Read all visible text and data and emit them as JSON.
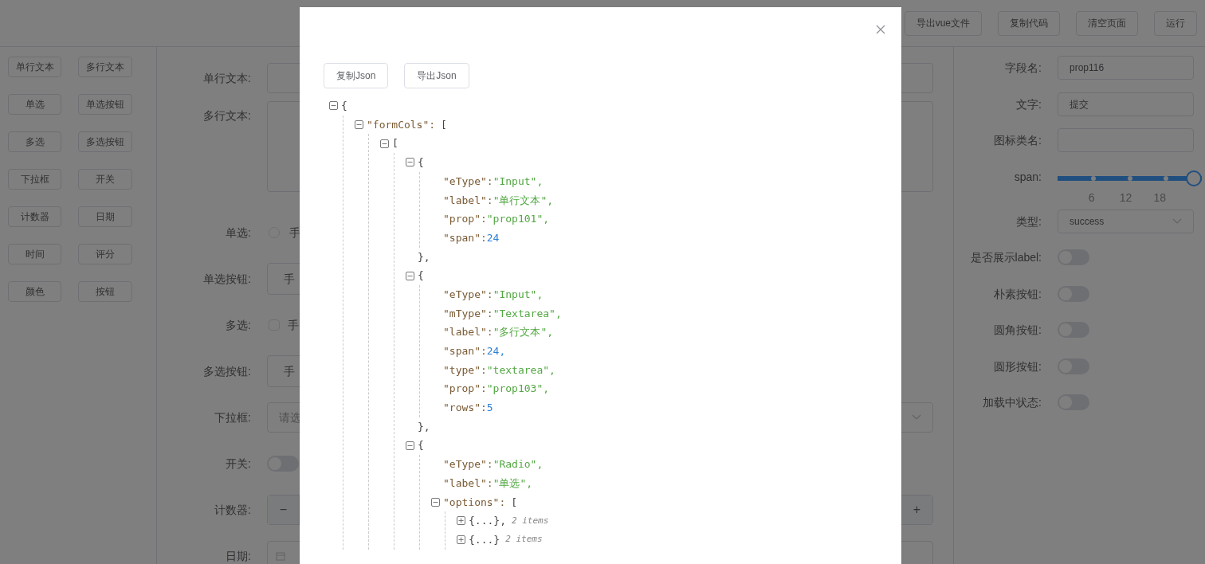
{
  "toolbar": {
    "buttons": [
      "导出vue文件",
      "复制代码",
      "清空页面",
      "运行"
    ]
  },
  "components": [
    "单行文本",
    "多行文本",
    "单选",
    "单选按钮",
    "多选",
    "多选按钮",
    "下拉框",
    "开关",
    "计数器",
    "日期",
    "时间",
    "评分",
    "颜色",
    "按钮"
  ],
  "form": {
    "rows": [
      {
        "kind": "input",
        "label": "单行文本:"
      },
      {
        "kind": "textarea",
        "label": "多行文本:"
      },
      {
        "kind": "radio",
        "label": "单选:",
        "option": "手",
        "checked": false
      },
      {
        "kind": "radio-button",
        "label": "单选按钮:",
        "option": "手"
      },
      {
        "kind": "checkbox",
        "label": "多选:",
        "option": "手",
        "checked": false
      },
      {
        "kind": "checkbox-button",
        "label": "多选按钮:",
        "option": "手"
      },
      {
        "kind": "select",
        "label": "下拉框:",
        "placeholder": "请选"
      },
      {
        "kind": "switch",
        "label": "开关:",
        "on": false
      },
      {
        "kind": "stepper",
        "label": "计数器:",
        "minus": "−",
        "plus": "+"
      },
      {
        "kind": "date",
        "label": "日期:"
      }
    ]
  },
  "properties": [
    {
      "kind": "input",
      "label": "字段名:",
      "value": "prop116"
    },
    {
      "kind": "input",
      "label": "文字:",
      "value": "提交"
    },
    {
      "kind": "input",
      "label": "图标类名:"
    },
    {
      "kind": "slider",
      "label": "span:",
      "level": 1,
      "marks": [
        "6",
        "12",
        "18"
      ]
    },
    {
      "kind": "select",
      "label": "类型:",
      "value": "success"
    },
    {
      "kind": "switch",
      "label": "是否展示label:",
      "on": false
    },
    {
      "kind": "switch",
      "label": "朴素按钮:",
      "on": false
    },
    {
      "kind": "switch",
      "label": "圆角按钮:",
      "on": false
    },
    {
      "kind": "switch",
      "label": "圆形按钮:",
      "on": false
    },
    {
      "kind": "switch",
      "label": "加载中状态:",
      "on": false
    }
  ],
  "modal": {
    "buttons": [
      "复制Json",
      "导出Json"
    ],
    "tree": {
      "kind": "branch",
      "open": "{",
      "expanded": true,
      "children": [
        {
          "kind": "branch",
          "key": "\"formCols\":",
          "open": "[",
          "expanded": true,
          "children": [
            {
              "kind": "branch",
              "open": "[",
              "expanded": true,
              "children": [
                {
                  "kind": "branch",
                  "open": "{",
                  "close": "},",
                  "expanded": true,
                  "children": [
                    {
                      "kind": "string-pair",
                      "key": "\"eType\":",
                      "value": "\"Input\","
                    },
                    {
                      "kind": "string-pair",
                      "key": "\"label\":",
                      "value": "\"单行文本\","
                    },
                    {
                      "kind": "string-pair",
                      "key": "\"prop\":",
                      "value": "\"prop101\","
                    },
                    {
                      "kind": "number-pair",
                      "key": "\"span\":",
                      "value": "24"
                    }
                  ]
                },
                {
                  "kind": "branch",
                  "open": "{",
                  "close": "},",
                  "expanded": true,
                  "children": [
                    {
                      "kind": "string-pair",
                      "key": "\"eType\":",
                      "value": "\"Input\","
                    },
                    {
                      "kind": "string-pair",
                      "key": "\"mType\":",
                      "value": "\"Textarea\","
                    },
                    {
                      "kind": "string-pair",
                      "key": "\"label\":",
                      "value": "\"多行文本\","
                    },
                    {
                      "kind": "number-pair",
                      "key": "\"span\":",
                      "value": "24,"
                    },
                    {
                      "kind": "string-pair",
                      "key": "\"type\":",
                      "value": "\"textarea\","
                    },
                    {
                      "kind": "string-pair",
                      "key": "\"prop\":",
                      "value": "\"prop103\","
                    },
                    {
                      "kind": "number-pair",
                      "key": "\"rows\":",
                      "value": "5"
                    }
                  ]
                },
                {
                  "kind": "branch",
                  "open": "{",
                  "expanded": true,
                  "children": [
                    {
                      "kind": "string-pair",
                      "key": "\"eType\":",
                      "value": "\"Radio\","
                    },
                    {
                      "kind": "string-pair",
                      "key": "\"label\":",
                      "value": "\"单选\","
                    },
                    {
                      "kind": "branch",
                      "key": "\"options\":",
                      "open": "[",
                      "expanded": true,
                      "children": [
                        {
                          "kind": "branch",
                          "open": "{...},",
                          "count": "2 items",
                          "expanded": false
                        },
                        {
                          "kind": "branch",
                          "open": "{...}",
                          "count": "2 items",
                          "expanded": false
                        }
                      ]
                    }
                  ]
                }
              ]
            }
          ]
        }
      ]
    }
  }
}
